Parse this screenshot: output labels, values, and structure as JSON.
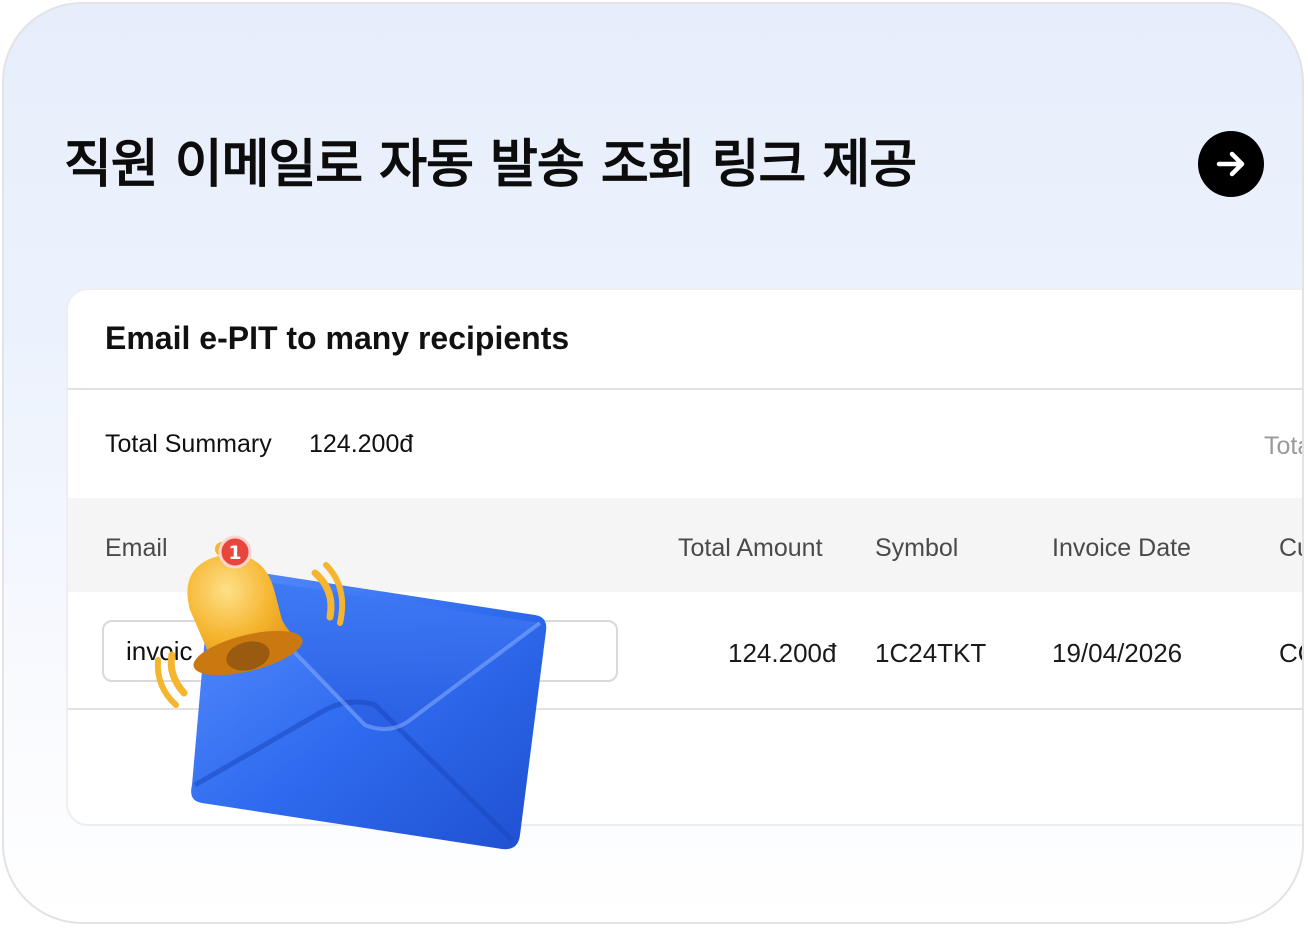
{
  "headline": "직원 이메일로 자동 발송 조회 링크 제공",
  "card": {
    "title": "Email e-PIT to many recipients",
    "summary_label": "Total Summary",
    "summary_value": "124.200đ",
    "summary_right_label": "Tota"
  },
  "table": {
    "headers": [
      "Email",
      "Total Amount",
      "Symbol",
      "Invoice Date",
      "Cu"
    ],
    "row": {
      "email": "invoic",
      "total_amount": "124.200đ",
      "symbol": "1C24TKT",
      "invoice_date": "19/04/2026",
      "cu": "CỔ"
    }
  },
  "notification_badge": "1",
  "icons": {
    "arrow": "arrow-right-icon",
    "envelope": "envelope-icon",
    "bell": "bell-icon"
  },
  "colors": {
    "background_top": "#e6eefc",
    "arrow_button": "#000000",
    "envelope": "#2f6cf0",
    "bell": "#f5b52e",
    "badge": "#e8453c"
  }
}
